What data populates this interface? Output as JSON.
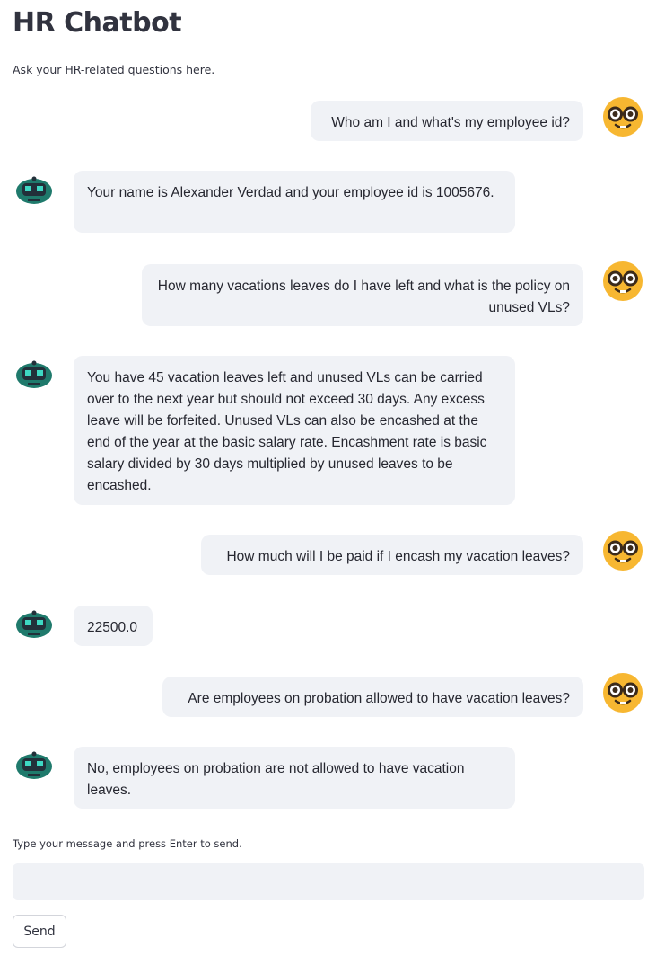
{
  "app": {
    "title": "HR Chatbot",
    "subtitle": "Ask your HR-related questions here."
  },
  "messages": [
    {
      "role": "user",
      "text": "Who am I and what's my employee id?"
    },
    {
      "role": "bot",
      "text": "Your name is Alexander Verdad and your employee id is 1005676."
    },
    {
      "role": "user",
      "text": "How many vacations leaves do I have left and what is the policy on unused VLs?"
    },
    {
      "role": "bot",
      "text": "You have 45 vacation leaves left and unused VLs can be carried over to the next year but should not exceed 30 days. Any excess leave will be forfeited. Unused VLs can also be encashed at the end of the year at the basic salary rate. Encashment rate is basic salary divided by 30 days multiplied by unused leaves to be encashed."
    },
    {
      "role": "user",
      "text": "How much will I be paid if I encash my vacation leaves?"
    },
    {
      "role": "bot",
      "text": "22500.0"
    },
    {
      "role": "user",
      "text": "Are employees on probation allowed to have vacation leaves?"
    },
    {
      "role": "bot",
      "text": "No, employees on probation are not allowed to have vacation leaves."
    }
  ],
  "icons": {
    "user_avatar": "nerd-face-icon",
    "bot_avatar": "robot-icon"
  },
  "input": {
    "label": "Type your message and press Enter to send.",
    "value": "",
    "placeholder": ""
  },
  "send_button": {
    "label": "Send"
  },
  "colors": {
    "bubble": "#f0f2f6",
    "user_avatar": "#f7b731",
    "bot_avatar": "#1f7a6c"
  }
}
